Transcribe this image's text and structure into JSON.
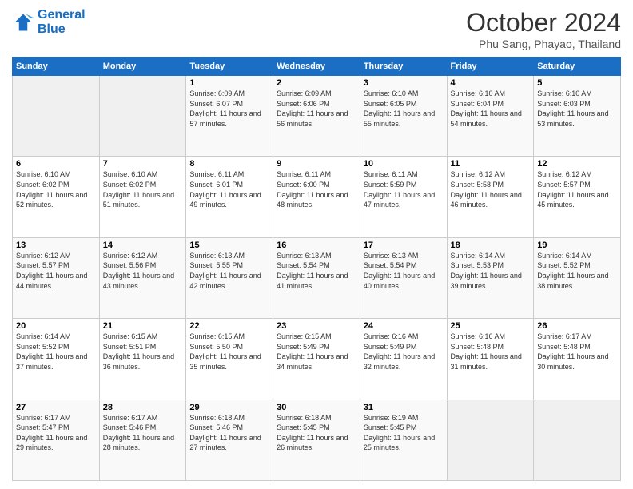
{
  "logo": {
    "line1": "General",
    "line2": "Blue"
  },
  "title": "October 2024",
  "location": "Phu Sang, Phayao, Thailand",
  "headers": [
    "Sunday",
    "Monday",
    "Tuesday",
    "Wednesday",
    "Thursday",
    "Friday",
    "Saturday"
  ],
  "weeks": [
    [
      {
        "day": "",
        "info": ""
      },
      {
        "day": "",
        "info": ""
      },
      {
        "day": "1",
        "info": "Sunrise: 6:09 AM\nSunset: 6:07 PM\nDaylight: 11 hours and 57 minutes."
      },
      {
        "day": "2",
        "info": "Sunrise: 6:09 AM\nSunset: 6:06 PM\nDaylight: 11 hours and 56 minutes."
      },
      {
        "day": "3",
        "info": "Sunrise: 6:10 AM\nSunset: 6:05 PM\nDaylight: 11 hours and 55 minutes."
      },
      {
        "day": "4",
        "info": "Sunrise: 6:10 AM\nSunset: 6:04 PM\nDaylight: 11 hours and 54 minutes."
      },
      {
        "day": "5",
        "info": "Sunrise: 6:10 AM\nSunset: 6:03 PM\nDaylight: 11 hours and 53 minutes."
      }
    ],
    [
      {
        "day": "6",
        "info": "Sunrise: 6:10 AM\nSunset: 6:02 PM\nDaylight: 11 hours and 52 minutes."
      },
      {
        "day": "7",
        "info": "Sunrise: 6:10 AM\nSunset: 6:02 PM\nDaylight: 11 hours and 51 minutes."
      },
      {
        "day": "8",
        "info": "Sunrise: 6:11 AM\nSunset: 6:01 PM\nDaylight: 11 hours and 49 minutes."
      },
      {
        "day": "9",
        "info": "Sunrise: 6:11 AM\nSunset: 6:00 PM\nDaylight: 11 hours and 48 minutes."
      },
      {
        "day": "10",
        "info": "Sunrise: 6:11 AM\nSunset: 5:59 PM\nDaylight: 11 hours and 47 minutes."
      },
      {
        "day": "11",
        "info": "Sunrise: 6:12 AM\nSunset: 5:58 PM\nDaylight: 11 hours and 46 minutes."
      },
      {
        "day": "12",
        "info": "Sunrise: 6:12 AM\nSunset: 5:57 PM\nDaylight: 11 hours and 45 minutes."
      }
    ],
    [
      {
        "day": "13",
        "info": "Sunrise: 6:12 AM\nSunset: 5:57 PM\nDaylight: 11 hours and 44 minutes."
      },
      {
        "day": "14",
        "info": "Sunrise: 6:12 AM\nSunset: 5:56 PM\nDaylight: 11 hours and 43 minutes."
      },
      {
        "day": "15",
        "info": "Sunrise: 6:13 AM\nSunset: 5:55 PM\nDaylight: 11 hours and 42 minutes."
      },
      {
        "day": "16",
        "info": "Sunrise: 6:13 AM\nSunset: 5:54 PM\nDaylight: 11 hours and 41 minutes."
      },
      {
        "day": "17",
        "info": "Sunrise: 6:13 AM\nSunset: 5:54 PM\nDaylight: 11 hours and 40 minutes."
      },
      {
        "day": "18",
        "info": "Sunrise: 6:14 AM\nSunset: 5:53 PM\nDaylight: 11 hours and 39 minutes."
      },
      {
        "day": "19",
        "info": "Sunrise: 6:14 AM\nSunset: 5:52 PM\nDaylight: 11 hours and 38 minutes."
      }
    ],
    [
      {
        "day": "20",
        "info": "Sunrise: 6:14 AM\nSunset: 5:52 PM\nDaylight: 11 hours and 37 minutes."
      },
      {
        "day": "21",
        "info": "Sunrise: 6:15 AM\nSunset: 5:51 PM\nDaylight: 11 hours and 36 minutes."
      },
      {
        "day": "22",
        "info": "Sunrise: 6:15 AM\nSunset: 5:50 PM\nDaylight: 11 hours and 35 minutes."
      },
      {
        "day": "23",
        "info": "Sunrise: 6:15 AM\nSunset: 5:49 PM\nDaylight: 11 hours and 34 minutes."
      },
      {
        "day": "24",
        "info": "Sunrise: 6:16 AM\nSunset: 5:49 PM\nDaylight: 11 hours and 32 minutes."
      },
      {
        "day": "25",
        "info": "Sunrise: 6:16 AM\nSunset: 5:48 PM\nDaylight: 11 hours and 31 minutes."
      },
      {
        "day": "26",
        "info": "Sunrise: 6:17 AM\nSunset: 5:48 PM\nDaylight: 11 hours and 30 minutes."
      }
    ],
    [
      {
        "day": "27",
        "info": "Sunrise: 6:17 AM\nSunset: 5:47 PM\nDaylight: 11 hours and 29 minutes."
      },
      {
        "day": "28",
        "info": "Sunrise: 6:17 AM\nSunset: 5:46 PM\nDaylight: 11 hours and 28 minutes."
      },
      {
        "day": "29",
        "info": "Sunrise: 6:18 AM\nSunset: 5:46 PM\nDaylight: 11 hours and 27 minutes."
      },
      {
        "day": "30",
        "info": "Sunrise: 6:18 AM\nSunset: 5:45 PM\nDaylight: 11 hours and 26 minutes."
      },
      {
        "day": "31",
        "info": "Sunrise: 6:19 AM\nSunset: 5:45 PM\nDaylight: 11 hours and 25 minutes."
      },
      {
        "day": "",
        "info": ""
      },
      {
        "day": "",
        "info": ""
      }
    ]
  ]
}
